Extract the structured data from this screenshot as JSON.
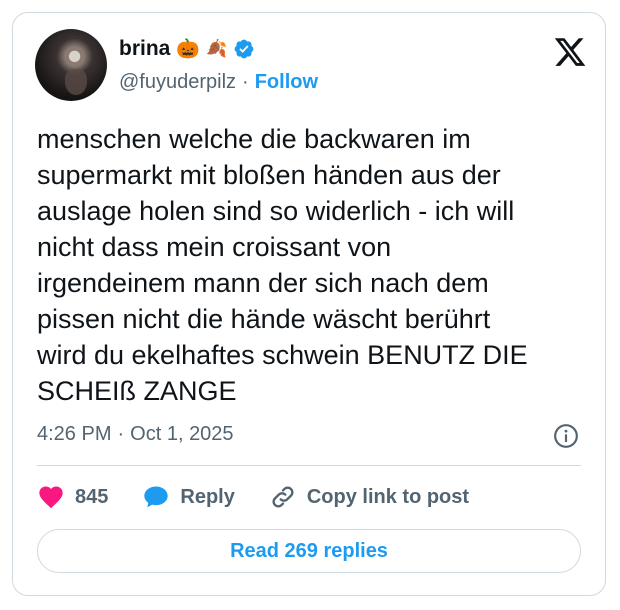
{
  "author": {
    "display_name": "brina",
    "emojis": [
      "🎃",
      "🍂"
    ],
    "handle": "@fuyuderpilz",
    "separator": "·",
    "follow_label": "Follow"
  },
  "icons": {
    "verified": "verified-badge-icon",
    "logo": "x-logo-icon",
    "info": "info-icon",
    "like": "heart-icon",
    "reply": "reply-bubble-icon",
    "copy": "link-icon"
  },
  "colors": {
    "accent": "#1d9bf0",
    "like": "#f91880",
    "text": "#0f1419",
    "muted": "#536471"
  },
  "tweet": {
    "text": "menschen welche die backwaren im\nsupermarkt mit bloßen händen aus der\nauslage holen sind so widerlich - ich will\nnicht dass mein croissant von\nirgendeinem mann der sich nach dem\npissen nicht die hände wäscht berührt\nwird du ekelhaftes schwein BENUTZ DIE\nSCHEIß ZANGE",
    "time": "4:26 PM",
    "separator": "·",
    "date": "Oct 1, 2025"
  },
  "actions": {
    "like_count": "845",
    "reply_label": "Reply",
    "copy_label": "Copy link to post"
  },
  "read_replies_label": "Read 269 replies"
}
